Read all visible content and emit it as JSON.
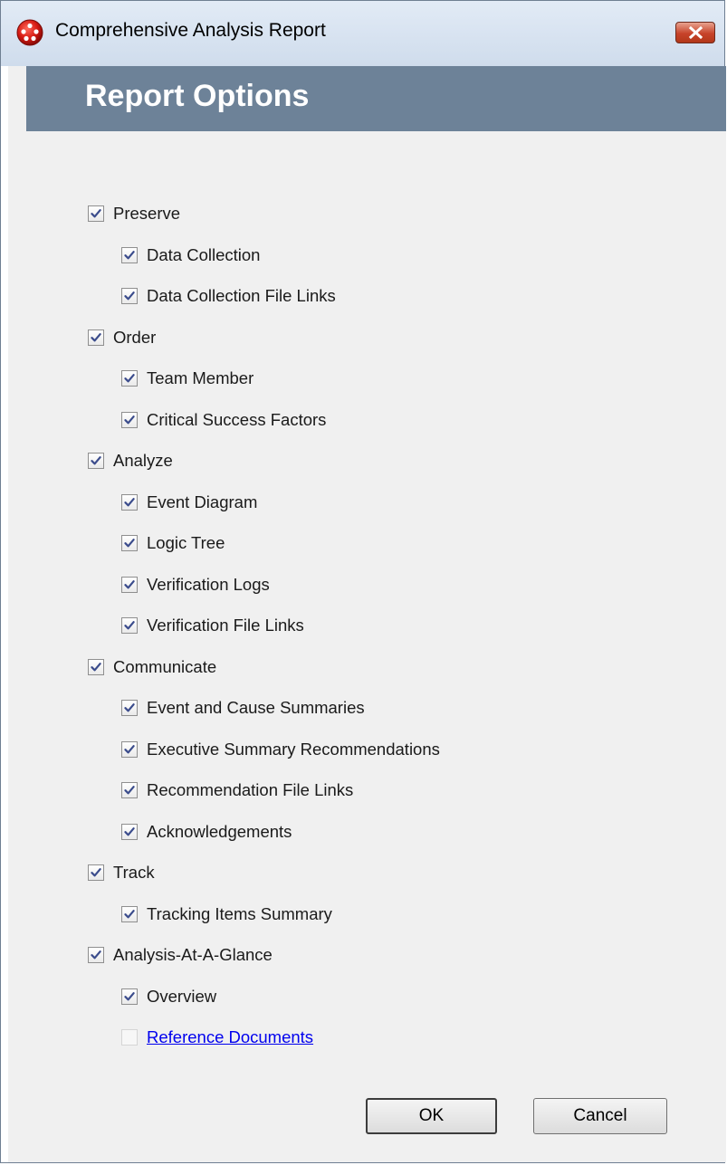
{
  "window": {
    "title": "Comprehensive Analysis Report",
    "app_icon": "red-ball-icon",
    "close_icon": "close-x-icon"
  },
  "header": {
    "title": "Report Options"
  },
  "options": [
    {
      "label": "Preserve",
      "checked": true,
      "level": 0
    },
    {
      "label": "Data Collection",
      "checked": true,
      "level": 1
    },
    {
      "label": "Data Collection File Links",
      "checked": true,
      "level": 1
    },
    {
      "label": "Order",
      "checked": true,
      "level": 0
    },
    {
      "label": "Team Member",
      "checked": true,
      "level": 1
    },
    {
      "label": "Critical Success Factors",
      "checked": true,
      "level": 1
    },
    {
      "label": "Analyze",
      "checked": true,
      "level": 0
    },
    {
      "label": "Event Diagram",
      "checked": true,
      "level": 1
    },
    {
      "label": "Logic Tree",
      "checked": true,
      "level": 1
    },
    {
      "label": "Verification Logs",
      "checked": true,
      "level": 1
    },
    {
      "label": "Verification File Links",
      "checked": true,
      "level": 1
    },
    {
      "label": "Communicate",
      "checked": true,
      "level": 0
    },
    {
      "label": "Event and Cause Summaries",
      "checked": true,
      "level": 1
    },
    {
      "label": "Executive Summary Recommendations",
      "checked": true,
      "level": 1
    },
    {
      "label": "Recommendation File Links",
      "checked": true,
      "level": 1
    },
    {
      "label": "Acknowledgements",
      "checked": true,
      "level": 1
    },
    {
      "label": "Track",
      "checked": true,
      "level": 0
    },
    {
      "label": "Tracking Items Summary",
      "checked": true,
      "level": 1
    },
    {
      "label": "Analysis-At-A-Glance",
      "checked": true,
      "level": 0
    },
    {
      "label": "Overview",
      "checked": true,
      "level": 1
    },
    {
      "label": "Reference Documents",
      "checked": false,
      "disabled": true,
      "link": true,
      "level": 1
    }
  ],
  "buttons": {
    "ok": "OK",
    "cancel": "Cancel"
  },
  "colors": {
    "header_band": "#6d8298",
    "dialog_background": "#f0f0f0",
    "link": "#0000ee",
    "close_button": "#c7432a"
  }
}
